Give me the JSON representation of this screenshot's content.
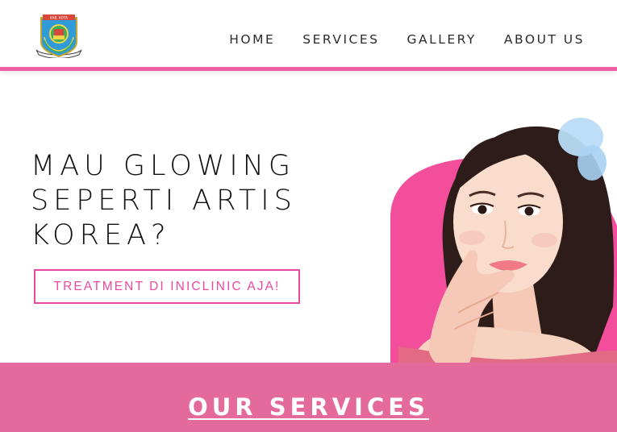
{
  "header": {
    "logo_icon": "regional-emblem-logo",
    "nav": [
      {
        "label": "HOME"
      },
      {
        "label": "SERVICES"
      },
      {
        "label": "GALLERY"
      },
      {
        "label": "ABOUT US"
      }
    ]
  },
  "hero": {
    "title": "MAU GLOWING\nSEPERTI ARTIS\nKOREA?",
    "cta_label": "TREATMENT DI INICLINIC AJA!",
    "image_icon": "woman-portrait-photo"
  },
  "services": {
    "title": "OUR SERVICES"
  },
  "colors": {
    "accent_pink": "#f25ea4",
    "band_pink": "#e46a9c",
    "cta_pink": "#e94aa0"
  }
}
